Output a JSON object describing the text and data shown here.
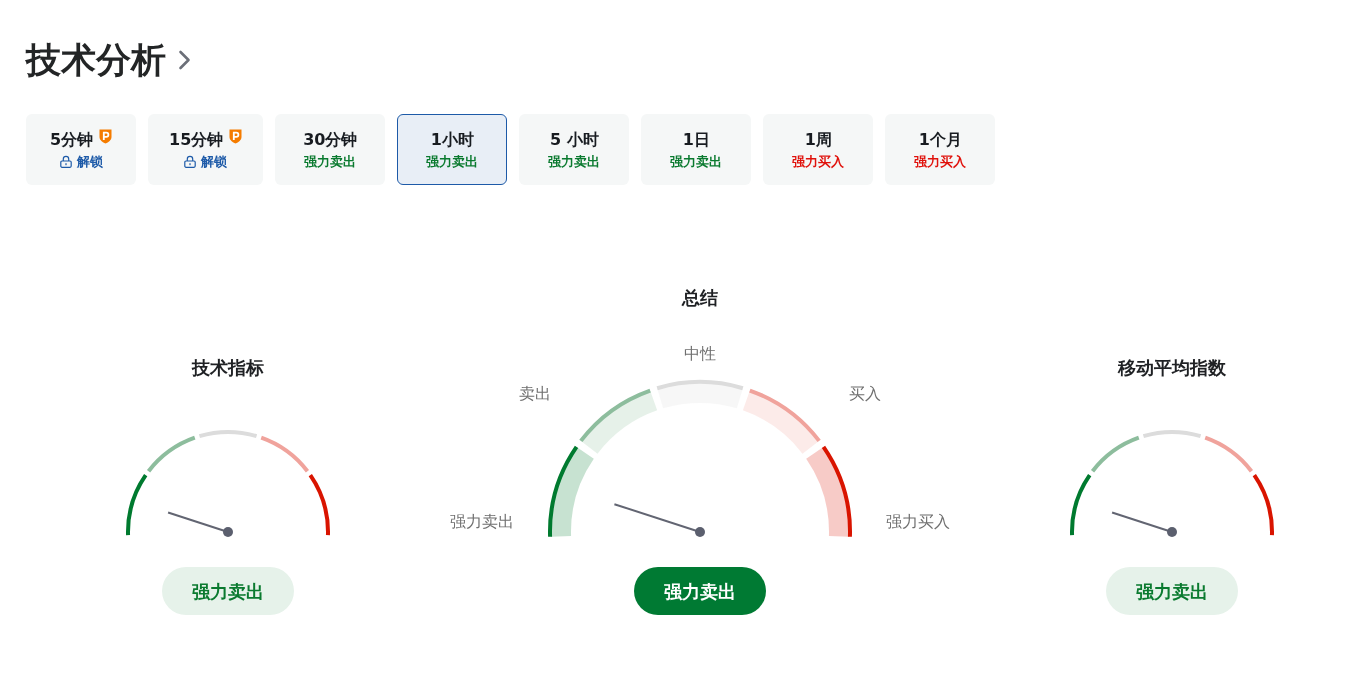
{
  "header": {
    "title": "技术分析"
  },
  "timeframes": [
    {
      "label": "5分钟",
      "pro": true,
      "status": "解锁",
      "kind": "locked",
      "selected": false
    },
    {
      "label": "15分钟",
      "pro": true,
      "status": "解锁",
      "kind": "locked",
      "selected": false
    },
    {
      "label": "30分钟",
      "pro": false,
      "status": "强力卖出",
      "kind": "sell",
      "selected": false
    },
    {
      "label": "1小时",
      "pro": false,
      "status": "强力卖出",
      "kind": "sell",
      "selected": true
    },
    {
      "label": "5 小时",
      "pro": false,
      "status": "强力卖出",
      "kind": "sell",
      "selected": false
    },
    {
      "label": "1日",
      "pro": false,
      "status": "强力卖出",
      "kind": "sell",
      "selected": false
    },
    {
      "label": "1周",
      "pro": false,
      "status": "强力买入",
      "kind": "buy",
      "selected": false
    },
    {
      "label": "1个月",
      "pro": false,
      "status": "强力买入",
      "kind": "buy",
      "selected": false
    }
  ],
  "gauges": [
    {
      "kind": "detail",
      "title": "技术指标",
      "segments": [
        {
          "color": "#007a2f",
          "selected": true
        },
        {
          "color": "#8dbd9d",
          "selected": false
        },
        {
          "color": "#dcdcdc",
          "selected": false
        },
        {
          "color": "#f0a39c",
          "selected": false
        },
        {
          "color": "#d91400",
          "selected": false
        }
      ],
      "result": "强力卖出"
    },
    {
      "kind": "summary",
      "title": "总结",
      "segments": [
        {
          "label": "强力卖出",
          "color": "#007a2f",
          "selected": true
        },
        {
          "label": "卖出",
          "color": "#8dbd9d",
          "selected": false
        },
        {
          "label": "中性",
          "color": "#dcdcdc",
          "selected": false
        },
        {
          "label": "买入",
          "color": "#f0a39c",
          "selected": false
        },
        {
          "label": "强力买入",
          "color": "#d91400",
          "selected": false
        }
      ],
      "result": "强力卖出"
    },
    {
      "kind": "detail",
      "title": "移动平均指数",
      "segments": [
        {
          "color": "#007a2f",
          "selected": true
        },
        {
          "color": "#8dbd9d",
          "selected": false
        },
        {
          "color": "#dcdcdc",
          "selected": false
        },
        {
          "color": "#f0a39c",
          "selected": false
        },
        {
          "color": "#d91400",
          "selected": false
        }
      ],
      "result": "强力卖出"
    }
  ]
}
